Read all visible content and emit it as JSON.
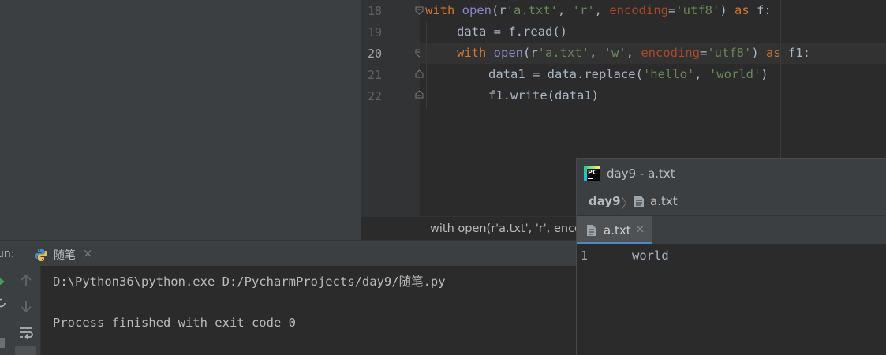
{
  "editor": {
    "line_numbers": [
      "18",
      "19",
      "20",
      "21",
      "22"
    ],
    "current_line": "20",
    "lines": [
      [
        {
          "t": "with",
          "c": "kw"
        },
        {
          "t": " ",
          "c": ""
        },
        {
          "t": "open",
          "c": "builtin"
        },
        {
          "t": "(r",
          "c": ""
        },
        {
          "t": "'a.txt'",
          "c": "str"
        },
        {
          "t": ", ",
          "c": ""
        },
        {
          "t": "'r'",
          "c": "str"
        },
        {
          "t": ", ",
          "c": ""
        },
        {
          "t": "encoding",
          "c": "param"
        },
        {
          "t": "=",
          "c": ""
        },
        {
          "t": "'utf8'",
          "c": "str"
        },
        {
          "t": ") ",
          "c": ""
        },
        {
          "t": "as",
          "c": "kw"
        },
        {
          "t": " f:",
          "c": ""
        }
      ],
      [
        {
          "t": "data = f.read()",
          "c": ""
        }
      ],
      [
        {
          "t": "with",
          "c": "kw"
        },
        {
          "t": " ",
          "c": ""
        },
        {
          "t": "open",
          "c": "builtin"
        },
        {
          "t": "(r",
          "c": ""
        },
        {
          "t": "'a.txt'",
          "c": "str"
        },
        {
          "t": ", ",
          "c": ""
        },
        {
          "t": "'w'",
          "c": "str"
        },
        {
          "t": ", ",
          "c": ""
        },
        {
          "t": "encoding",
          "c": "param"
        },
        {
          "t": "=",
          "c": ""
        },
        {
          "t": "'utf8'",
          "c": "str"
        },
        {
          "t": ") ",
          "c": ""
        },
        {
          "t": "as",
          "c": "kw"
        },
        {
          "t": " f1:",
          "c": ""
        }
      ],
      [
        {
          "t": "data1 = data.replace(",
          "c": ""
        },
        {
          "t": "'hello'",
          "c": "str"
        },
        {
          "t": ", ",
          "c": ""
        },
        {
          "t": "'world'",
          "c": "str"
        },
        {
          "t": ")",
          "c": ""
        }
      ],
      [
        {
          "t": "f1.write(data1)",
          "c": ""
        }
      ]
    ],
    "breadcrumb": "with open(r'a.txt', 'r', enco"
  },
  "run": {
    "label": "un:",
    "tab_label": "随笔",
    "tab_close": "×",
    "console_lines": [
      "D:\\Python36\\python.exe D:/PycharmProjects/day9/随笔.py",
      "Process finished with exit code 0"
    ],
    "toolbar_icons": [
      "arrow-up-icon",
      "arrow-down-icon",
      "soft-wrap-icon"
    ]
  },
  "popup": {
    "title": "day9 - a.txt",
    "nav_project": "day9",
    "nav_separator": "〉",
    "nav_file": "a.txt",
    "tab_label": "a.txt",
    "tab_close": "×",
    "line_no": "1",
    "content": "world"
  },
  "colors": {
    "keyword": "#cc7832",
    "string": "#6a8759",
    "builtin": "#8888c6",
    "param": "#aa4926",
    "tab_underline": "#4a88c7",
    "run_green": "#499c54"
  }
}
